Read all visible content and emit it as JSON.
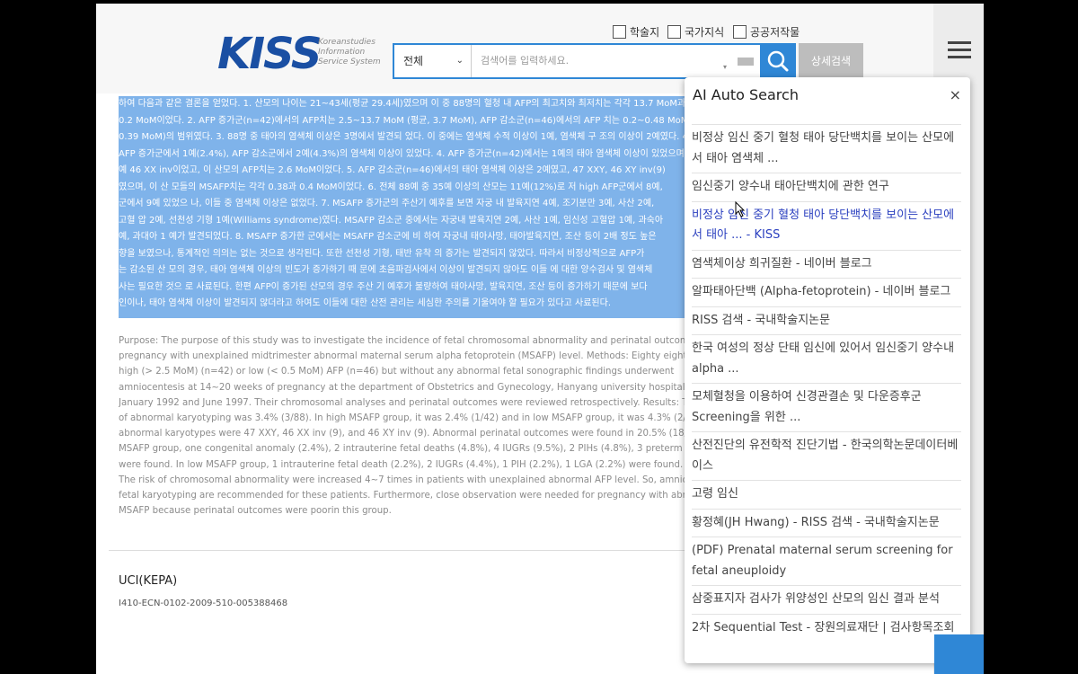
{
  "header": {
    "logo_text": "KISS",
    "logo_sub": [
      "Koreanstudies",
      "Information",
      "Service System"
    ],
    "checkboxes": [
      "학술지",
      "국가지식",
      "공공저작물"
    ],
    "search_scope": "전체",
    "search_placeholder": "검색어를 입력하세요.",
    "detail_button": "상세검색"
  },
  "content": {
    "korean_abstract_lines": [
      "하여 다음과 같은 결론을 얻었다. 1. 산모의 나이는 21~43세(평균 29.4세)였으며 이 중 88명의 혈청 내 AFP의 최고치와 최저치는 각각 13.7 MoM과",
      "0.2 MoM이었다. 2. AFP 증가군(n=42)에서의 AFP치는 2.5~13.7 MoM (평균, 3.7 MoM), AFP 감소군(n=46)에서의 AFP 치는 0.2~0.48 MoM (평균,",
      "0.39 MoM)의 범위였다. 3. 88명 중 태아의 염색체 이상은 3명에서 발견되 었다. 이 중에는 염색체 수적 이상이 1예, 염색체 구 조의 이상이 2예였다. 4.",
      "AFP 증가군에서 1예(2.4%), AFP 감소군에서 2예(4.3%)의 염색체 이상이 있었다. 4. AFP 증가군(n=42)에서는 1예의 태아 염색체 이상이 있었으며 이는",
      "예 46 XX inv이었고, 이 산모의 AFP치는 2.6 MoM이었다. 5. AFP 감소군(n=46)에서의 태아 염색체 이상은 2예였고, 47 XXY, 46 XY inv(9)",
      "였으며, 이 산 모들의 MSAFP치는 각각 0.38과 0.4 MoM이었다. 6. 전체 88예 중 35예 이상의 산모는 11예(12%)로 저 high AFP군에서 8예,",
      "군에서 9예 있었으 나, 이들 중 염색체 이상은 없었다. 7. MSAFP 증가군의 주산기 예후를 보면 자궁 내 발육지연 4예, 조기분만 3예, 사산 2예,",
      "고혈 압 2예, 선천성 기형 1예(Williams syndrome)였다. MSAFP 감소군 중에서는 자궁내 발육지연 2예, 사산 1예, 임신성 고혈압 1예, 과숙아",
      "예, 과대아 1 예가 발견되었다. 8. MSAFP 증가한 군에서는 MSAFP 감소군에 비 하여 자궁내 태아사망, 태아발육지연, 조산 등이 2배 정도 높은",
      "향을 보였으나, 통계적인 의의는 없는 것으로 생각된다. 또한 선천성 기형, 태반 유착 의 증가는 발견되지 않았다. 따라서 비정상적으로 AFP가",
      "는 감소된 산 모의 경우, 태아 염색체 이상의 빈도가 증가하기 때 문에 초음파검사에서 이상이 발견되지 않아도 이들 에 대한 양수검사 및 염색체",
      "사는 필요한 것으 로 사료된다. 한편 AFP이 증가된 산모의 경우 주산 기 예후가 불량하여 태아사망, 발육지연, 조산 등이 증가하기 때문에 보다",
      "인이나, 태아 염색체 이상이 발견되지 않더라고 하여도 이들에 대한 산전 관리는 세심한 주의를 기울여야 할 필요가 있다고 사료된다."
    ],
    "english_abstract_lines": [
      "Purpose: The purpose of this study was to investigate the incidence of fetal chromosomal abnormality and perinatal outcome",
      "pregnancy with unexplained midtrimester abnormal maternal serum alpha fetoprotein (MSAFP) level. Methods: Eighty eight pa",
      "high (> 2.5 MoM) (n=42) or low (< 0.5 MoM) AFP (n=46) but without any abnormal fetal sonographic findings underwent",
      "amniocentesis at 14~20 weeks of pregnancy at the department of Obstetrics and Gynecology, Hanyang university hospital betw",
      "January 1992 and June 1997. Their chromosomal analyses and perinatal outcomes were reviewed retrospectively. Results: The",
      "of abnormal karyotyping was 3.4% (3/88). In high MSAFP group, it was 2.4% (1/42) and in low MSAFP group, it was 4.3% (2/46).",
      "abnormal karyotypes were 47 XXY, 46 XX inv (9), and 46 XY inv (9). Abnormal perinatal outcomes were found in 20.5% (18/88). I",
      "MSAFP group, one congenital anomaly (2.4%), 2 intrauterine fetal deaths (4.8%), 4 IUGRs (9.5%), 2 PIHs (4.8%), 3 preterm delive",
      "were found. In low MSAFP group, 1 intrauterine fetal death (2.2%), 2 IUGRs (4.4%), 1 PIH (2.2%), 1 LGA (2.2%) were found. Conc",
      "The risk of chromosomal abnormality were increased 4~7 times in patients with unexplained abnormal AFP level. So, amnioce",
      "fetal karyotyping are recommended for these patients. Furthermore, close observation were needed for pregnancy with abnor",
      "MSAFP because perinatal outcomes were poorin this group."
    ],
    "uci_label": "UCI(KEPA)",
    "uci_value": "I410-ECN-0102-2009-510-005388468"
  },
  "ai_search": {
    "title": "AI Auto Search",
    "close": "×",
    "items": [
      {
        "text": "비정상 임신 중기 혈청 태아 당단백치를 보이는 산모에서 태아 염색체 ...",
        "active": false
      },
      {
        "text": "임신중기 양수내 태아단백치에 관한 연구",
        "active": false
      },
      {
        "text": "비정상 임신 중기 혈청 태아 당단백치를 보이는 산모에서 태아 ... - KISS",
        "active": true
      },
      {
        "text": "염색체이상 희귀질환 - 네이버 블로그",
        "active": false
      },
      {
        "text": "알파태아단백 (Alpha-fetoprotein) - 네이버 블로그",
        "active": false
      },
      {
        "text": "RISS 검색 - 국내학술지논문",
        "active": false
      },
      {
        "text": "한국 여성의 정상 단태 임신에 있어서 임신중기 양수내 alpha ...",
        "active": false
      },
      {
        "text": "모체혈청을 이용하여 신경관결손 및 다운증후군 Screening을 위한 ...",
        "active": false
      },
      {
        "text": "산전진단의 유전학적 진단기법 - 한국의학논문데이터베이스",
        "active": false
      },
      {
        "text": "고령 임신",
        "active": false
      },
      {
        "text": "황정혜(JH Hwang) - RISS 검색 - 국내학술지논문",
        "active": false
      },
      {
        "text": "(PDF) Prenatal maternal serum screening for fetal aneuploidy",
        "active": false
      },
      {
        "text": "삼중표지자 검사가 위양성인 산모의 임신 결과 분석",
        "active": false
      },
      {
        "text": "2차 Sequential Test - 장원의료재단 | 검사항목조회",
        "active": false
      }
    ]
  },
  "icons": {
    "search": "search-icon",
    "menu": "hamburger-icon",
    "close": "close-icon",
    "dropdown": "chevron-down-icon",
    "keyboard": "keyboard-icon",
    "cursor": "mouse-cursor-icon"
  },
  "colors": {
    "brand": "#1a4fa3",
    "accent": "#2f87d6",
    "highlight": "#7fb3ea",
    "active_link": "#2a3fbf"
  }
}
